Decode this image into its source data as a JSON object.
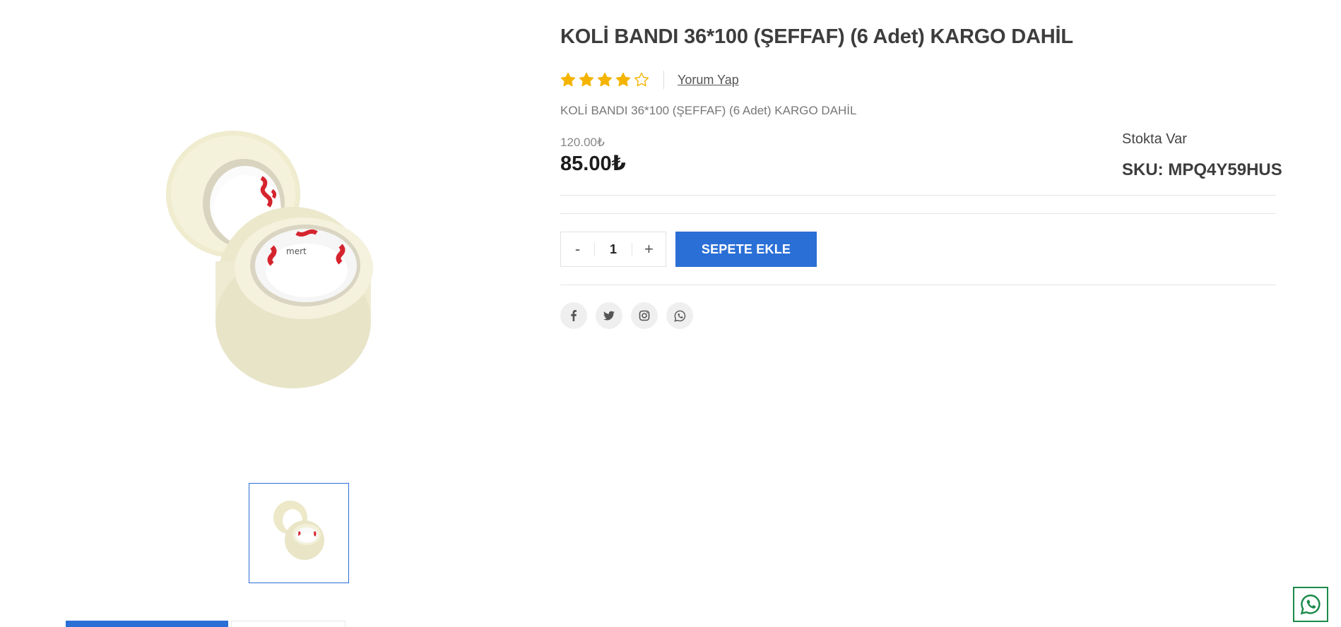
{
  "product": {
    "title": "KOLİ BANDI 36*100 (ŞEFFAF) (6 Adet) KARGO DAHİL",
    "short_description": "KOLİ BANDI 36*100 (ŞEFFAF) (6 Adet) KARGO DAHİL",
    "rating": {
      "value": 4,
      "max": 5,
      "star_color": "#f4b400"
    },
    "review_link_label": "Yorum Yap",
    "old_price": "120.00₺",
    "price": "85.00₺",
    "stock_status": "Stokta Var",
    "sku_label": "SKU:",
    "sku_value": "MPQ4Y59HUS",
    "image_icon": "packing-tape-image"
  },
  "cart": {
    "decrement_label": "-",
    "quantity": "1",
    "increment_label": "+",
    "add_to_cart_label": "SEPETE EKLE"
  },
  "share": {
    "icons": [
      "facebook-icon",
      "twitter-icon",
      "instagram-icon",
      "whatsapp-icon"
    ]
  },
  "floating": {
    "icon": "whatsapp-icon",
    "color": "#1a8a4a"
  },
  "theme": {
    "accent": "#2a6fd6"
  }
}
